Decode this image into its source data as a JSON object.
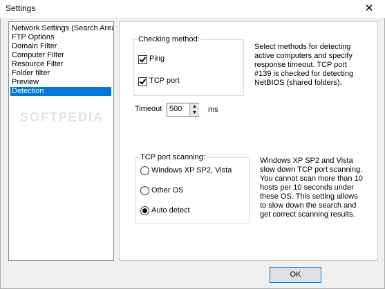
{
  "window": {
    "title": "Settings",
    "close_glyph": "✕"
  },
  "sidebar": {
    "items": [
      {
        "label": "Network Settings (Search Area)"
      },
      {
        "label": "FTP Options"
      },
      {
        "label": "Domain Filter"
      },
      {
        "label": "Computer Filter"
      },
      {
        "label": "Resource Filter"
      },
      {
        "label": "Folder filter"
      },
      {
        "label": "Preview"
      },
      {
        "label": "Detection"
      }
    ],
    "selected": "Detection",
    "watermark": "SOFTPEDIA"
  },
  "checking": {
    "legend": "Checking method:",
    "ping": {
      "label": "Ping",
      "checked": true
    },
    "tcp": {
      "label": "TCP port",
      "checked": true
    },
    "description": "Select methods for detecting active computers and specify response timeout. TCP port #139 is checked for detecting NetBIOS (shared folders)."
  },
  "timeout": {
    "label": "Timeout",
    "value": "500",
    "unit": "ms"
  },
  "scanning": {
    "legend": "TCP port scanning:",
    "options": [
      {
        "label": "Windows XP SP2, Vista",
        "selected": false
      },
      {
        "label": "Other OS",
        "selected": false
      },
      {
        "label": "Auto detect",
        "selected": true
      }
    ],
    "description": "Windows XP SP2 and Vista slow down TCP port scanning. You cannot scan more than 10 hosts per 10 seconds under these OS. This setting allows to slow down the search and get correct scanning results."
  },
  "buttons": {
    "ok": "OK"
  },
  "colors": {
    "selection": "#0078d7",
    "focus_border": "#0078d7"
  },
  "icons": {
    "close": "close-icon",
    "spin_up": "up-arrow-icon",
    "spin_down": "down-arrow-icon"
  }
}
